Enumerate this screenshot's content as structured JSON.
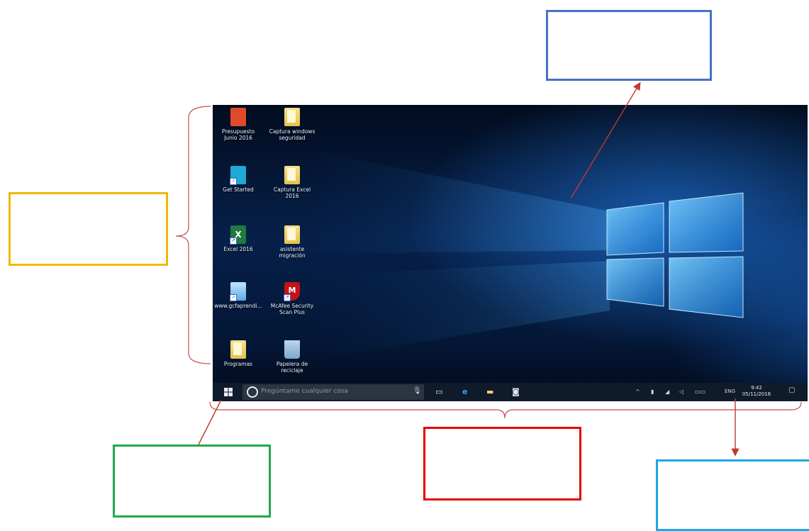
{
  "desktop": {
    "icons": [
      {
        "label": "Presupuesto\nJunio 2016",
        "icon": "office-doc-icon"
      },
      {
        "label": "Captura windows\nseguridad",
        "icon": "folder-icon"
      },
      {
        "label": "Get Started",
        "icon": "get-started-icon"
      },
      {
        "label": "Captura Excel\n2016",
        "icon": "folder-icon"
      },
      {
        "label": "Excel 2016",
        "icon": "excel-icon"
      },
      {
        "label": "asistente\nmigración",
        "icon": "folder-icon"
      },
      {
        "label": "www.gcfaprendi...",
        "icon": "web-shortcut-icon"
      },
      {
        "label": "McAfee Security\nScan Plus",
        "icon": "mcafee-icon"
      },
      {
        "label": "Programas",
        "icon": "folder-icon"
      },
      {
        "label": "Papelera de\nreciclaje",
        "icon": "recycle-bin-icon"
      }
    ]
  },
  "taskbar": {
    "search_placeholder": "Pregúntame cualquier cosa",
    "language": "ENG",
    "time": "9:42",
    "date": "05/11/2016"
  },
  "colors": {
    "blue_box": "#4472c4",
    "yellow_box": "#f2b705",
    "green_box": "#22a94b",
    "red_box": "#e60000",
    "cyan_box": "#1ea7e8"
  }
}
